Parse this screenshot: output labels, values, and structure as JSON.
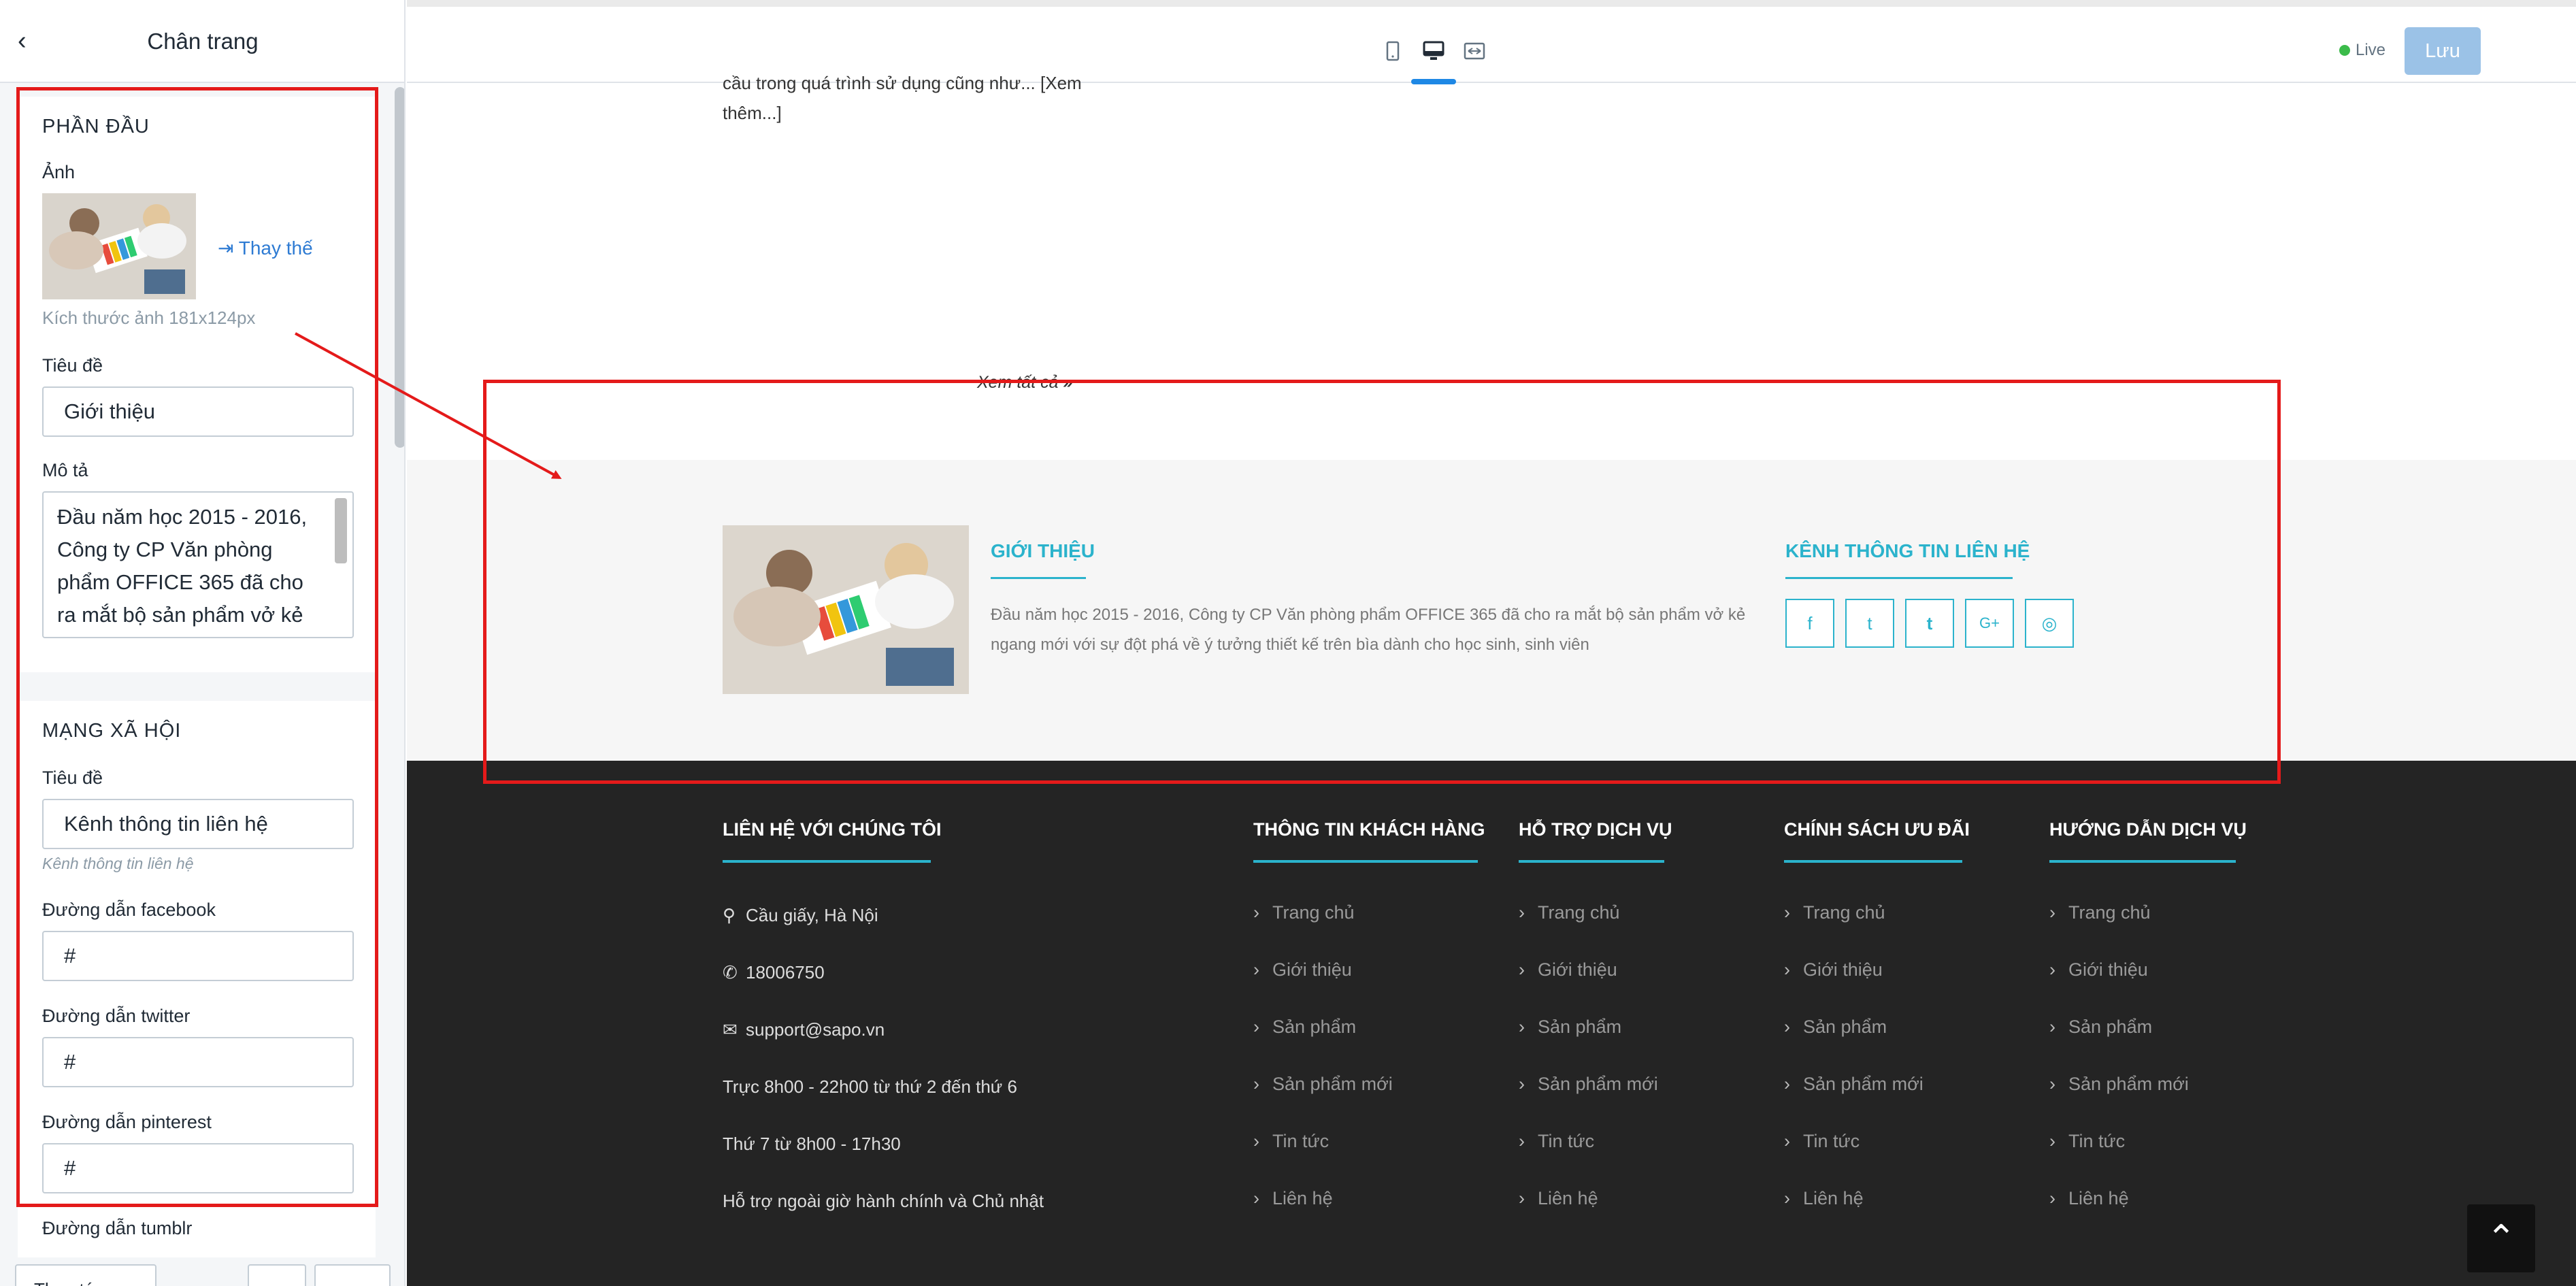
{
  "sidebar": {
    "back_icon": "chevron-left-icon",
    "title": "Chân trang",
    "header_section": {
      "title": "PHẦN ĐẦU",
      "image_label": "Ảnh",
      "replace_label": "Thay thế",
      "image_size_hint": "Kích thước ảnh 181x124px",
      "title_label": "Tiêu đề",
      "title_value": "Giới thiệu",
      "description_label": "Mô tả",
      "description_value": "Đầu năm học 2015 - 2016, Công ty CP Văn phòng phẩm OFFICE 365 đã cho ra mắt bộ sản phẩm vở kẻ"
    },
    "social_section": {
      "title": "MẠNG XÃ HỘI",
      "title_label": "Tiêu đề",
      "title_value": "Kênh thông tin liên hệ",
      "title_hint": "Kênh thông tin liên hệ",
      "facebook_label": "Đường dẫn facebook",
      "facebook_value": "#",
      "twitter_label": "Đường dẫn twitter",
      "twitter_value": "#",
      "pinterest_label": "Đường dẫn pinterest",
      "pinterest_value": "#",
      "tumblr_label": "Đường dẫn tumblr"
    },
    "footer_btn_1": "Thao tác",
    "footer_btn_2": "←",
    "footer_btn_3": "→"
  },
  "topbar": {
    "live_label": "Live",
    "save_label": "Lưu",
    "colors": {
      "active": "#1e88e5",
      "save_bg": "#9bc2e7",
      "live_dot": "#3bbb4a"
    }
  },
  "preview": {
    "excerpt_line1": "cầu trong quá trình sử dụng cũng như... [Xem",
    "excerpt_line2": "thêm...]",
    "view_all": "Xem tất cả",
    "about_title": "GIỚI THIỆU",
    "about_text": "Đầu năm học 2015 - 2016, Công ty CP Văn phòng phẩm OFFICE 365 đã cho ra mắt bộ sản phẩm vở kẻ ngang mới với sự đột phá về ý tưởng thiết kế trên bìa dành cho học sinh, sinh viên",
    "social_title": "KÊNH THÔNG TIN LIÊN HỆ",
    "social_icons": [
      "f",
      "t",
      "t",
      "G+",
      "◎"
    ],
    "contact_title": "LIÊN HỆ VỚI CHÚNG TÔI",
    "contact_address": "Cầu giấy, Hà Nội",
    "contact_phone": "18006750",
    "contact_email": "support@sapo.vn",
    "contact_hours_1": "Trực 8h00 - 22h00 từ thứ 2 đến thứ 6",
    "contact_hours_2": "Thứ 7 từ 8h00 - 17h30",
    "contact_hours_3": "Hỗ trợ ngoài giờ hành chính và Chủ nhật",
    "columns": [
      {
        "title": "THÔNG TIN KHÁCH HÀNG",
        "items": [
          "Trang chủ",
          "Giới thiệu",
          "Sản phẩm",
          "Sản phẩm mới",
          "Tin tức",
          "Liên hệ"
        ]
      },
      {
        "title": "HỖ TRỢ DỊCH VỤ",
        "items": [
          "Trang chủ",
          "Giới thiệu",
          "Sản phẩm",
          "Sản phẩm mới",
          "Tin tức",
          "Liên hệ"
        ]
      },
      {
        "title": "CHÍNH SÁCH ƯU ĐÃI",
        "items": [
          "Trang chủ",
          "Giới thiệu",
          "Sản phẩm",
          "Sản phẩm mới",
          "Tin tức",
          "Liên hệ"
        ]
      },
      {
        "title": "HƯỚNG DẪN DỊCH VỤ",
        "items": [
          "Trang chủ",
          "Giới thiệu",
          "Sản phẩm",
          "Sản phẩm mới",
          "Tin tức",
          "Liên hệ"
        ]
      }
    ],
    "colors": {
      "accent": "#2bb3cc",
      "dark_bg": "#242424",
      "annotation": "#e41a1a"
    }
  }
}
